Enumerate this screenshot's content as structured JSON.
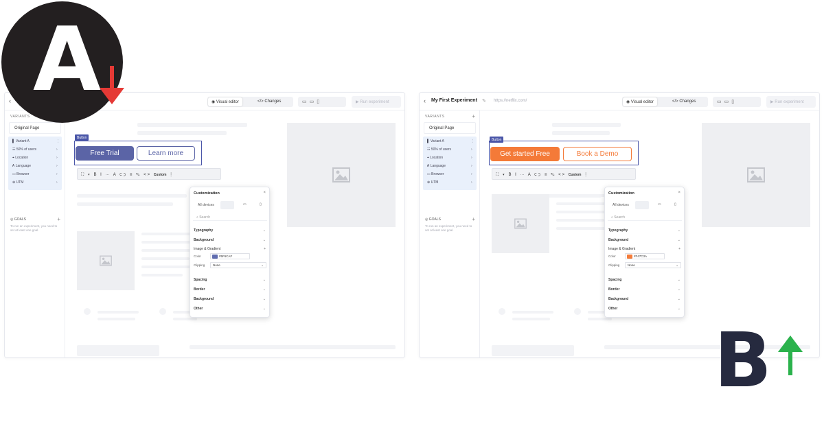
{
  "badges": {
    "a_letter": "A",
    "b_letter": "B",
    "a_arrow": "arrow-down",
    "b_arrow": "arrow-up",
    "down_color": "#e53935",
    "up_color": "#2bb24c"
  },
  "panel_a": {
    "topbar": {
      "back": "‹",
      "experiment_title": "",
      "url": "",
      "visual_editor": "Visual editor",
      "changes": "Changes",
      "run": "Run experiment"
    },
    "sidebar": {
      "heading": "VARIANTS",
      "original": "Original Page",
      "variant": "Variant A",
      "rows": [
        "50% of users",
        "Location",
        "Language",
        "Browser",
        "UTM"
      ],
      "goals": "GOALS",
      "goals_hint": "To run an experiment, you need to set at least one goal."
    },
    "canvas": {
      "element_label": "Button",
      "cta_primary": "Free Trial",
      "cta_secondary": "Learn more",
      "toolbar_custom": "Custom"
    },
    "customization": {
      "title": "Customization",
      "devices": "All devices",
      "search": "Search",
      "sections": [
        "Typography",
        "Background",
        "Image & Gradient"
      ],
      "color_label": "Color",
      "color_value": "#5F6CAF",
      "clipping_label": "Clipping",
      "clipping_value": "None",
      "sections_more": [
        "Spacing",
        "Border",
        "Background",
        "Other"
      ]
    }
  },
  "panel_b": {
    "topbar": {
      "back": "‹",
      "experiment_title": "My First Experiment",
      "url": "https://netflix.com/",
      "visual_editor": "Visual editor",
      "changes": "Changes",
      "run": "Run experiment"
    },
    "sidebar": {
      "heading": "VARIANTS",
      "original": "Original Page",
      "variant": "Variant A",
      "rows": [
        "50% of users",
        "Location",
        "Language",
        "Browser",
        "UTM"
      ],
      "goals": "GOALS",
      "goals_hint": "To run an experiment, you need to set at least one goal."
    },
    "canvas": {
      "element_label": "Button",
      "cta_primary": "Get started Free",
      "cta_secondary": "Book a Demo",
      "toolbar_custom": "Custom"
    },
    "customization": {
      "title": "Customization",
      "devices": "All devices",
      "search": "Search",
      "sections": [
        "Typography",
        "Background",
        "Image & Gradient"
      ],
      "color_label": "Color",
      "color_value": "#F47C3A",
      "clipping_label": "Clipping",
      "clipping_value": "None",
      "sections_more": [
        "Spacing",
        "Border",
        "Background",
        "Other"
      ]
    }
  }
}
